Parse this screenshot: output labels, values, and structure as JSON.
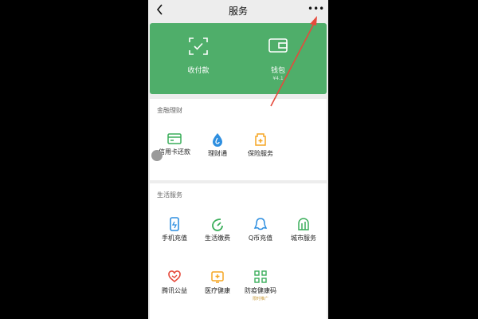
{
  "header": {
    "title": "服务",
    "more_label": "•••"
  },
  "wallet": {
    "items": [
      {
        "label": "收付款",
        "icon": "qr-scan-icon"
      },
      {
        "label": "钱包",
        "sub": "¥4.1",
        "icon": "wallet-icon"
      }
    ]
  },
  "finance": {
    "title": "金融理财",
    "items": [
      {
        "label": "信用卡还款",
        "icon": "credit-card-icon"
      },
      {
        "label": "理财通",
        "icon": "water-drop-icon"
      },
      {
        "label": "保险服务",
        "icon": "insurance-icon"
      }
    ]
  },
  "life": {
    "title": "生活服务",
    "items": [
      {
        "label": "手机充值",
        "icon": "phone-icon"
      },
      {
        "label": "生活缴费",
        "icon": "leaf-icon"
      },
      {
        "label": "Q币充值",
        "icon": "qq-icon"
      },
      {
        "label": "城市服务",
        "icon": "city-icon"
      },
      {
        "label": "腾讯公益",
        "icon": "heart-icon"
      },
      {
        "label": "医疗健康",
        "icon": "medical-icon"
      },
      {
        "label": "防疫健康码",
        "sub": "限时推广",
        "icon": "qr-code-icon"
      }
    ]
  },
  "colors": {
    "wallet_green": "#4fae6a",
    "arrow_red": "#e64a3c",
    "accent_orange": "#f5a623"
  }
}
